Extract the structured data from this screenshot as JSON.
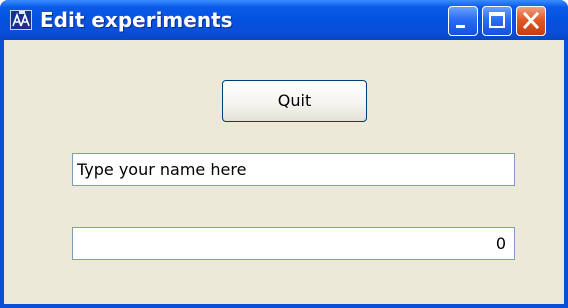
{
  "window": {
    "title": "Edit experiments",
    "controls": {
      "minimize_icon": "minimize-icon",
      "maximize_icon": "maximize-icon",
      "close_icon": "close-icon"
    },
    "app_icon": "app-icon"
  },
  "form": {
    "quit_label": "Quit",
    "name_input_value": "Type your name here",
    "counter_value": "0"
  },
  "colors": {
    "titlebar": "#0a4fd8",
    "client_background": "#ece9d8",
    "close_button": "#e05a28",
    "field_border": "#7f9db9"
  }
}
